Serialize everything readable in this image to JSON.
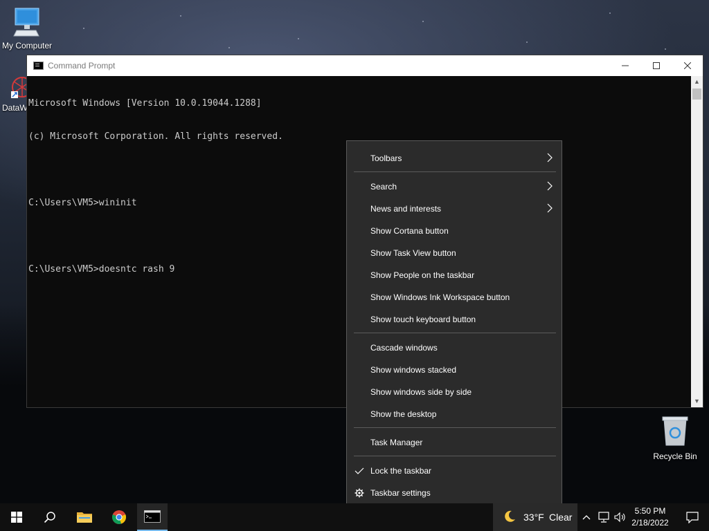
{
  "desktop": {
    "icons": [
      {
        "label": "My Computer"
      },
      {
        "label": "DataW"
      },
      {
        "label": "Recycle Bin"
      }
    ]
  },
  "cmd": {
    "title": "Command Prompt",
    "lines": [
      "Microsoft Windows [Version 10.0.19044.1288]",
      "(c) Microsoft Corporation. All rights reserved.",
      "",
      "C:\\Users\\VM5>wininit",
      "",
      "C:\\Users\\VM5>doesntc rash 9"
    ],
    "controls": {
      "minimize": "minimize-icon",
      "maximize": "maximize-icon",
      "close": "close-icon"
    }
  },
  "context_menu": {
    "items": [
      {
        "label": "Toolbars",
        "submenu": true
      },
      {
        "label": "Search",
        "submenu": true
      },
      {
        "label": "News and interests",
        "submenu": true
      },
      {
        "label": "Show Cortana button"
      },
      {
        "label": "Show Task View button"
      },
      {
        "label": "Show People on the taskbar"
      },
      {
        "label": "Show Windows Ink Workspace button"
      },
      {
        "label": "Show touch keyboard button"
      },
      {
        "label": "Cascade windows"
      },
      {
        "label": "Show windows stacked"
      },
      {
        "label": "Show windows side by side"
      },
      {
        "label": "Show the desktop"
      },
      {
        "label": "Task Manager"
      },
      {
        "label": "Lock the taskbar",
        "checked": true
      },
      {
        "label": "Taskbar settings",
        "icon": "gear-icon"
      }
    ]
  },
  "taskbar": {
    "weather": {
      "temp": "33°F",
      "condition": "Clear",
      "icon": "moon-icon"
    },
    "clock": {
      "time": "5:50 PM",
      "date": "2/18/2022"
    },
    "accent": "#76b9ed"
  }
}
